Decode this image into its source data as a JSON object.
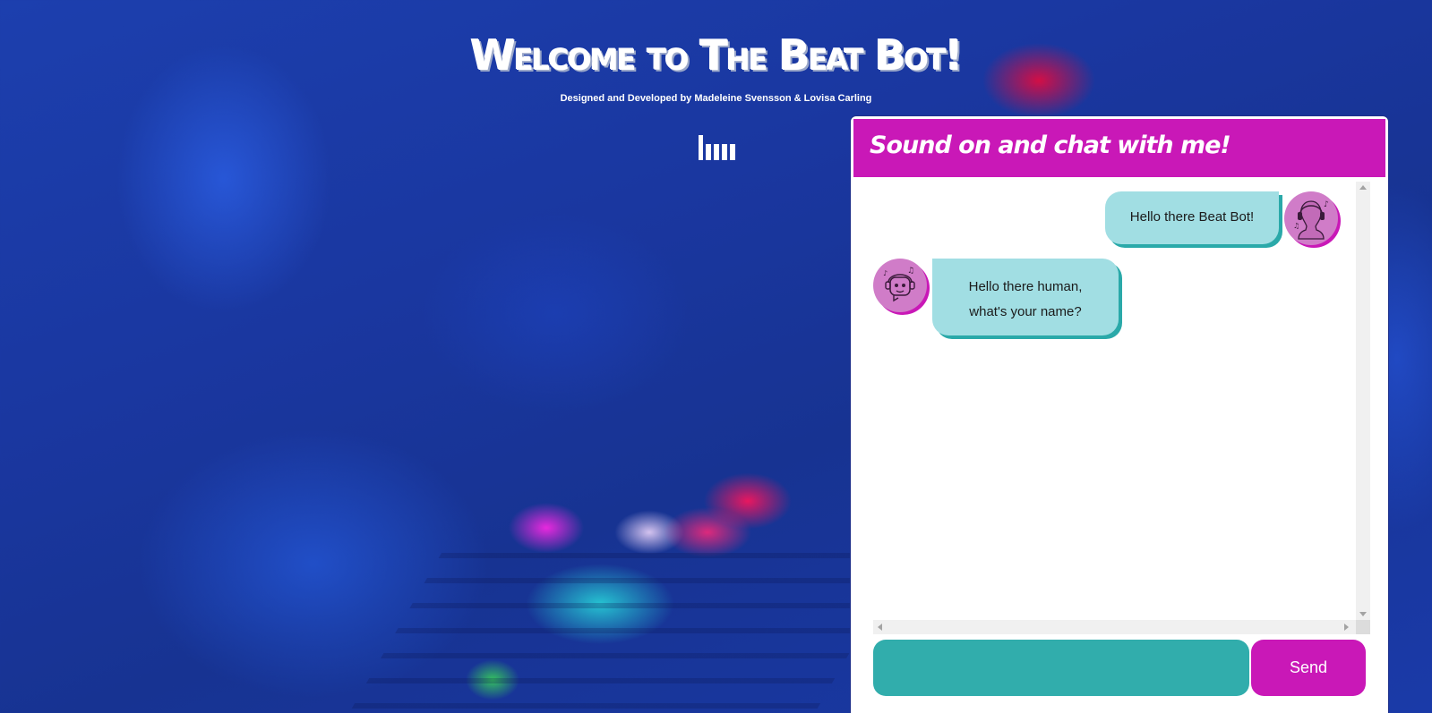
{
  "header": {
    "title": "Welcome to The Beat Bot!",
    "subtitle": "Designed and Developed by Madeleine Svensson & Lovisa Carling",
    "sound_icon": "equalizer-bars-icon"
  },
  "chat": {
    "heading": "Sound on and chat with me!",
    "messages": [
      {
        "sender": "user",
        "text": "Hello there Beat Bot!",
        "avatar_icon": "human-head-music-icon"
      },
      {
        "sender": "bot",
        "text": "Hello there human, what's your name?",
        "avatar_icon": "robot-music-icon"
      }
    ],
    "input": {
      "value": "",
      "placeholder": ""
    },
    "send_label": "Send"
  },
  "colors": {
    "accent": "#c918b7",
    "bubble": "#a1dee3",
    "bubble_shadow": "#2aa9a9",
    "input": "#31adac",
    "avatar": "#d07cc8"
  }
}
